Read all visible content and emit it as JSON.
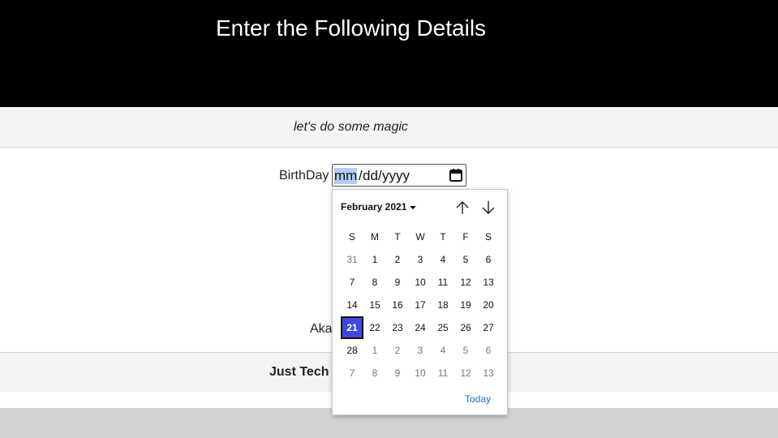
{
  "header": {
    "title": "Enter the Following Details"
  },
  "tagline": "let's do some magic",
  "form": {
    "birthday_label": "BirthDay",
    "date_input": {
      "mm": "mm",
      "dd": "dd",
      "yyyy": "yyyy",
      "sep": "/"
    },
    "aka_label": "Aka"
  },
  "footer": {
    "text": "Just Tech"
  },
  "date_picker": {
    "month_label": "February 2021",
    "weekdays": [
      "S",
      "M",
      "T",
      "W",
      "T",
      "F",
      "S"
    ],
    "weeks": [
      [
        "31",
        "1",
        "2",
        "3",
        "4",
        "5",
        "6"
      ],
      [
        "7",
        "8",
        "9",
        "10",
        "11",
        "12",
        "13"
      ],
      [
        "14",
        "15",
        "16",
        "17",
        "18",
        "19",
        "20"
      ],
      [
        "21",
        "22",
        "23",
        "24",
        "25",
        "26",
        "27"
      ],
      [
        "28",
        "1",
        "2",
        "3",
        "4",
        "5",
        "6"
      ],
      [
        "7",
        "8",
        "9",
        "10",
        "11",
        "12",
        "13"
      ]
    ],
    "selected_day": "21",
    "today_label": "Today",
    "accent_color": "#3f48e0",
    "link_color": "#1a6fc4"
  }
}
